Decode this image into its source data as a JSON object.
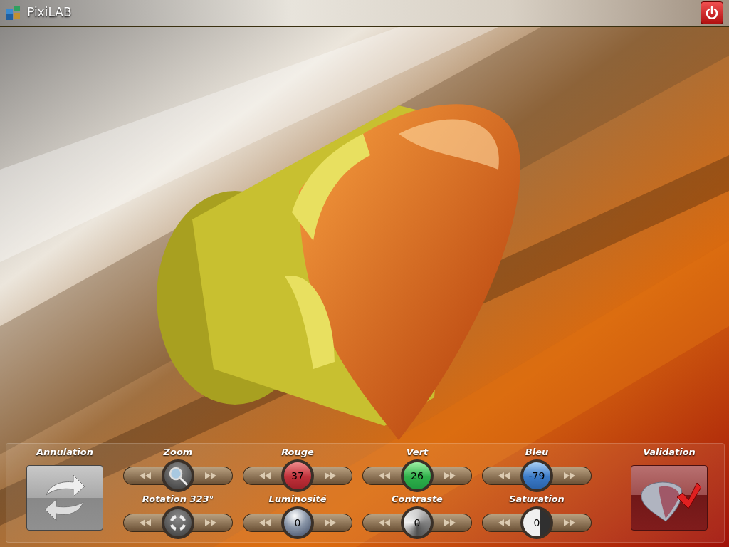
{
  "app": {
    "title": "PixiLAB"
  },
  "panel": {
    "undo": {
      "label": "Annulation"
    },
    "confirm": {
      "label": "Validation"
    },
    "controls": [
      {
        "kind": "zoom",
        "label": "Zoom"
      },
      {
        "kind": "red",
        "label": "Rouge",
        "value": "37"
      },
      {
        "kind": "green",
        "label": "Vert",
        "value": "26"
      },
      {
        "kind": "blue",
        "label": "Bleu",
        "value": "-79"
      },
      {
        "kind": "rotation",
        "label": "Rotation 323°"
      },
      {
        "kind": "brightness",
        "label": "Luminosité",
        "value": "0"
      },
      {
        "kind": "contrast",
        "label": "Contraste",
        "value": "0"
      },
      {
        "kind": "saturation",
        "label": "Saturation",
        "value": "0"
      }
    ]
  }
}
